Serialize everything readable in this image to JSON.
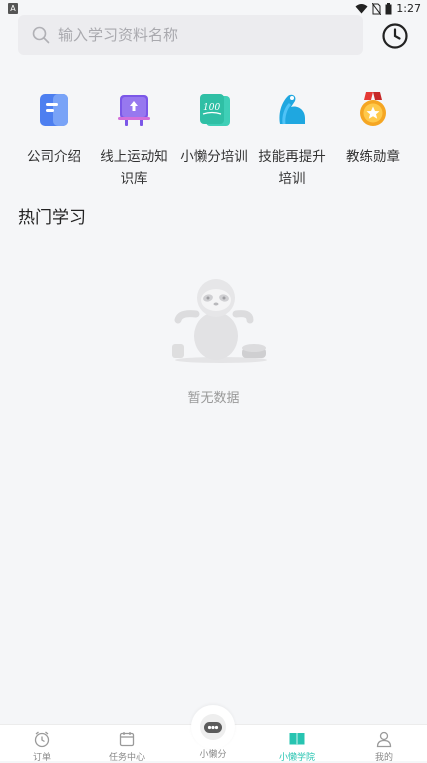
{
  "status_bar": {
    "time": "1:27",
    "left_badge": "A"
  },
  "search": {
    "placeholder": "输入学习资料名称"
  },
  "menu": [
    {
      "label": "公司介绍",
      "icon": "company-intro-icon"
    },
    {
      "label": "线上运动知识库",
      "icon": "knowledge-base-icon"
    },
    {
      "label": "小懒分培训",
      "icon": "training-icon"
    },
    {
      "label": "技能再提升培训",
      "icon": "skill-up-icon"
    },
    {
      "label": "教练勋章",
      "icon": "medal-icon"
    }
  ],
  "section": {
    "title": "热门学习"
  },
  "empty": {
    "text": "暂无数据"
  },
  "tabbar": {
    "orders": "订单",
    "tasks": "任务中心",
    "center": "小懒分",
    "academy": "小懒学院",
    "mine": "我的"
  },
  "colors": {
    "accent": "#27c4b1",
    "background": "#f5f6f8"
  }
}
